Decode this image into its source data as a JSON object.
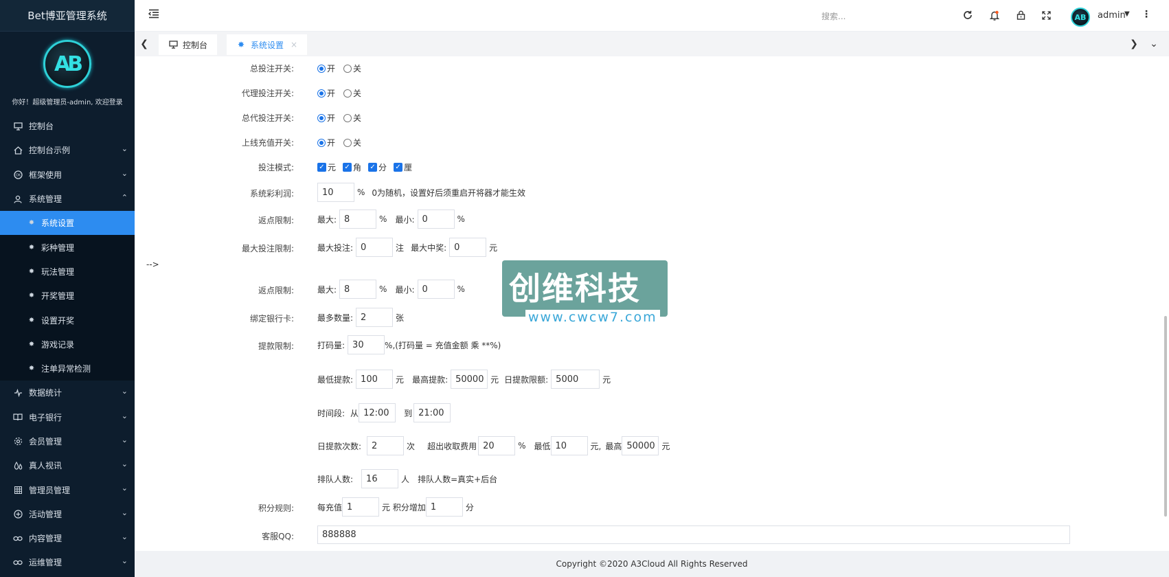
{
  "app": {
    "brand": "Bet博亚管理系统",
    "logo_text": "AB",
    "welcome": "你好！超级管理员-admin, 欢迎登录"
  },
  "sidebar": {
    "items": [
      {
        "label": "控制台",
        "icon": "monitor-icon",
        "chevron": ""
      },
      {
        "label": "控制台示例",
        "icon": "home-icon",
        "chevron": "⌄"
      },
      {
        "label": "框架使用",
        "icon": "ok-icon",
        "chevron": "⌄"
      },
      {
        "label": "系统管理",
        "icon": "user-icon",
        "chevron": "⌃"
      }
    ],
    "sub_items": [
      {
        "label": "系统设置",
        "icon": "fan-icon",
        "active": true
      },
      {
        "label": "彩种管理",
        "icon": "fan-icon"
      },
      {
        "label": "玩法管理",
        "icon": "fan-icon"
      },
      {
        "label": "开奖管理",
        "icon": "fan-icon"
      },
      {
        "label": "设置开奖",
        "icon": "fan-icon"
      },
      {
        "label": "游戏记录",
        "icon": "fan-icon"
      },
      {
        "label": "注单异常检测",
        "icon": "fan-icon"
      }
    ],
    "items_after": [
      {
        "label": "数据统计",
        "icon": "pulse-icon",
        "chevron": "⌄"
      },
      {
        "label": "电子银行",
        "icon": "book-icon",
        "chevron": "⌄"
      },
      {
        "label": "会员管理",
        "icon": "gear-icon",
        "chevron": "⌄"
      },
      {
        "label": "真人视讯",
        "icon": "drops-icon",
        "chevron": "⌄"
      },
      {
        "label": "管理员管理",
        "icon": "grid-icon",
        "chevron": "⌄"
      },
      {
        "label": "活动管理",
        "icon": "plus-circle-icon",
        "chevron": "⌄"
      },
      {
        "label": "内容管理",
        "icon": "link-icon",
        "chevron": "⌄"
      },
      {
        "label": "运维管理",
        "icon": "link-icon",
        "chevron": "⌄"
      }
    ]
  },
  "header": {
    "search_placeholder": "搜索...",
    "username": "admin",
    "avatar_text": "AB",
    "icons": [
      "refresh-icon",
      "bell-icon",
      "lock-icon",
      "fullscreen-icon"
    ]
  },
  "tabs": [
    {
      "label": "控制台",
      "icon": "monitor-icon",
      "active": false
    },
    {
      "label": "系统设置",
      "icon": "fan-icon",
      "active": true,
      "close": "×"
    }
  ],
  "stray_text": "-->",
  "form": {
    "total_bet_switch": {
      "label": "总投注开关:",
      "on": "开",
      "off": "关",
      "selected": "开"
    },
    "agent_bet_switch": {
      "label": "代理投注开关:",
      "on": "开",
      "off": "关",
      "selected": "开"
    },
    "general_agent_bet_switch": {
      "label": "总代投注开关:",
      "on": "开",
      "off": "关",
      "selected": "开"
    },
    "online_recharge_switch": {
      "label": "上线充值开关:",
      "on": "开",
      "off": "关",
      "selected": "开"
    },
    "bet_mode": {
      "label": "投注模式:",
      "options": [
        "元",
        "角",
        "分",
        "厘"
      ],
      "checked": [
        true,
        true,
        true,
        true
      ]
    },
    "system_profit": {
      "label": "系统彩利润:",
      "value": "10",
      "unit": "%",
      "note": "0为随机，设置好后须重启开将器才能生效"
    },
    "rebate_limit_1": {
      "label": "返点限制:",
      "max_label": "最大:",
      "max_value": "8",
      "unit1": "%",
      "min_label": "最小:",
      "min_value": "0",
      "unit2": "%"
    },
    "max_bet_limit": {
      "label": "最大投注限制:",
      "max_bet_label": "最大投注:",
      "max_bet_value": "0",
      "bet_unit": "注",
      "max_win_label": "最大中奖:",
      "max_win_value": "0",
      "win_unit": "元"
    },
    "rebate_limit_2": {
      "label": "返点限制:",
      "max_label": "最大:",
      "max_value": "8",
      "unit1": "%",
      "min_label": "最小:",
      "min_value": "0",
      "unit2": "%"
    },
    "bank_card": {
      "label": "绑定银行卡:",
      "count_label": "最多数量:",
      "count_value": "2",
      "unit": "张"
    },
    "withdraw_limit": {
      "label": "提款限制:",
      "code_label": "打码量:",
      "code_value": "30",
      "code_note": "%,(打码量 = 充值金额 乘 **%)",
      "min_label": "最低提款:",
      "min_value": "100",
      "min_unit": "元",
      "max_label": "最高提款:",
      "max_value": "50000",
      "max_unit": "元",
      "daily_label": "日提款限额:",
      "daily_value": "5000",
      "daily_unit": "元",
      "period_label": "时间段:",
      "from_label": "从",
      "from_value": "12:00",
      "to_label": "到",
      "to_value": "21:00",
      "times_label": "日提款次数:",
      "times_value": "2",
      "times_unit": "次",
      "fee_label": "超出收取费用",
      "fee_value": "20",
      "fee_unit": "%",
      "fee_min_label": "最低",
      "fee_min_value": "10",
      "fee_min_unit": "元,",
      "fee_max_label": "最高",
      "fee_max_value": "50000",
      "fee_max_unit": "元",
      "queue_label": "排队人数:",
      "queue_value": "16",
      "queue_unit": "人",
      "queue_note": "排队人数=真实+后台"
    },
    "points_rule": {
      "label": "积分规则:",
      "per_label": "每充值",
      "per_value": "1",
      "per_unit": "元 积分增加",
      "add_value": "1",
      "add_unit": "分"
    },
    "service_qq": {
      "label": "客服QQ:",
      "value": "888888"
    }
  },
  "watermark": {
    "text": "创维科技",
    "url": "www.cwcw7.com"
  },
  "footer": {
    "copyright": "Copyright ©2020 A3Cloud All Rights Reserved"
  }
}
